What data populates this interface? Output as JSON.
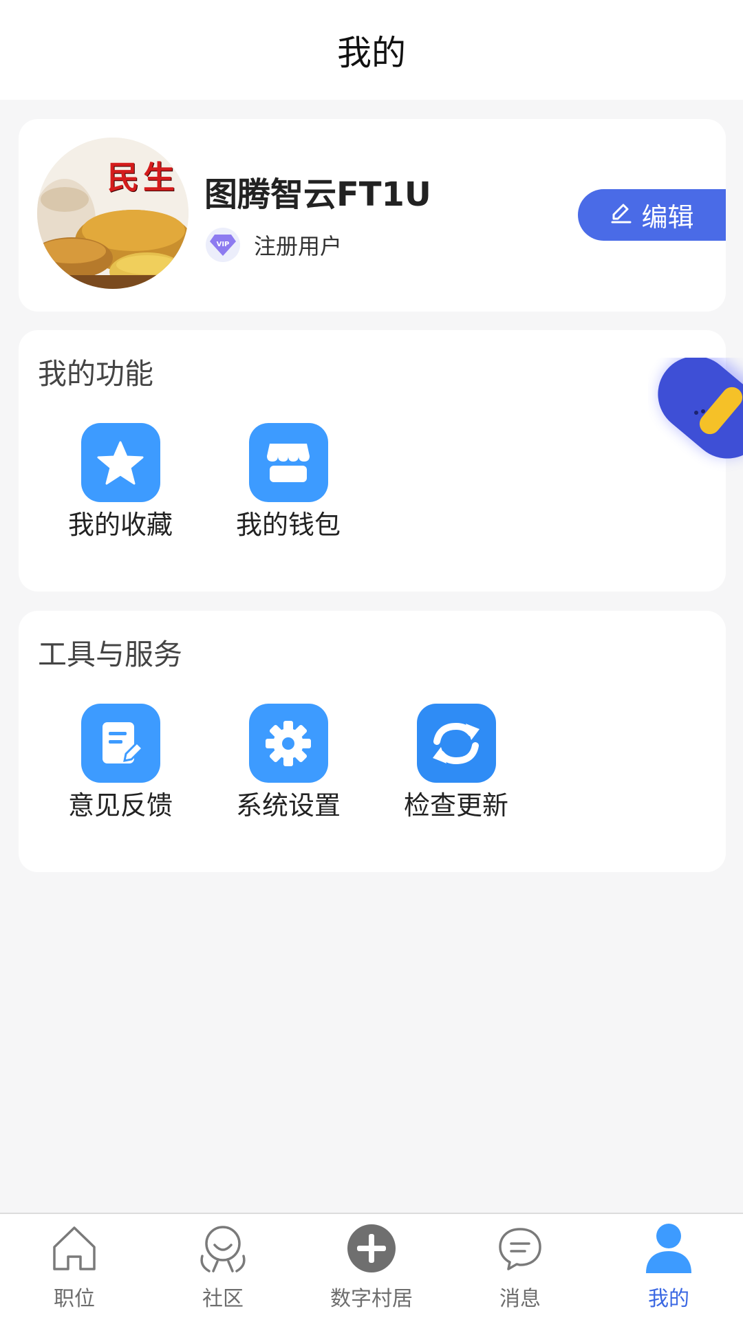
{
  "header": {
    "title": "我的"
  },
  "profile": {
    "avatar_text": "民生",
    "username": "图腾智云FT1U",
    "vip_badge": "VIP",
    "user_type": "注册用户",
    "edit_label": "编辑"
  },
  "features": {
    "title": "我的功能",
    "items": [
      {
        "label": "我的收藏",
        "icon": "star-icon"
      },
      {
        "label": "我的钱包",
        "icon": "wallet-icon"
      }
    ]
  },
  "tools": {
    "title": "工具与服务",
    "items": [
      {
        "label": "意见反馈",
        "icon": "feedback-icon"
      },
      {
        "label": "系统设置",
        "icon": "gear-icon"
      },
      {
        "label": "检查更新",
        "icon": "refresh-icon"
      }
    ]
  },
  "tabbar": {
    "items": [
      {
        "label": "职位",
        "icon": "home-icon",
        "active": false
      },
      {
        "label": "社区",
        "icon": "community-icon",
        "active": false
      },
      {
        "label": "数字村居",
        "icon": "plus-circle-icon",
        "active": false
      },
      {
        "label": "消息",
        "icon": "chat-icon",
        "active": false
      },
      {
        "label": "我的",
        "icon": "user-icon",
        "active": true
      }
    ]
  },
  "colors": {
    "accent": "#3b68e3",
    "icon_blue": "#3d9bff",
    "edit_button": "#4a6be7",
    "background": "#f6f6f7"
  }
}
